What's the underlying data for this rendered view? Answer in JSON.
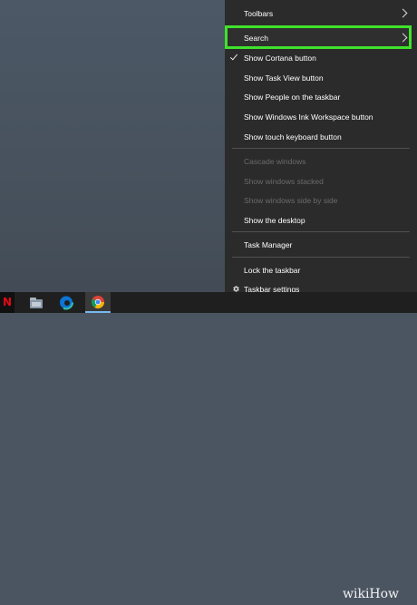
{
  "context_menu": {
    "items": [
      {
        "label": "Toolbars",
        "has_submenu": true
      },
      {
        "label": "Search",
        "has_submenu": true,
        "highlighted": true
      },
      {
        "label": "Show Cortana button",
        "checked": true
      },
      {
        "label": "Show Task View button"
      },
      {
        "label": "Show People on the taskbar"
      },
      {
        "label": "Show Windows Ink Workspace button"
      },
      {
        "label": "Show touch keyboard button"
      },
      {
        "label": "Cascade windows",
        "disabled": true
      },
      {
        "label": "Show windows stacked",
        "disabled": true
      },
      {
        "label": "Show windows side by side",
        "disabled": true
      },
      {
        "label": "Show the desktop"
      },
      {
        "label": "Task Manager"
      },
      {
        "label": "Lock the taskbar"
      },
      {
        "label": "Taskbar settings",
        "icon": "gear-icon"
      }
    ]
  },
  "taskbar": {
    "icons": [
      "netflix-icon",
      "file-explorer-icon",
      "edge-icon",
      "chrome-icon"
    ],
    "netflix_glyph": "N"
  },
  "watermark": {
    "text": "wikiHow"
  },
  "colors": {
    "highlight_border": "#3fe22b",
    "menu_background": "#2b2b2b",
    "taskbar_background": "#1f1f1f",
    "desktop_background": "#4b5562"
  }
}
